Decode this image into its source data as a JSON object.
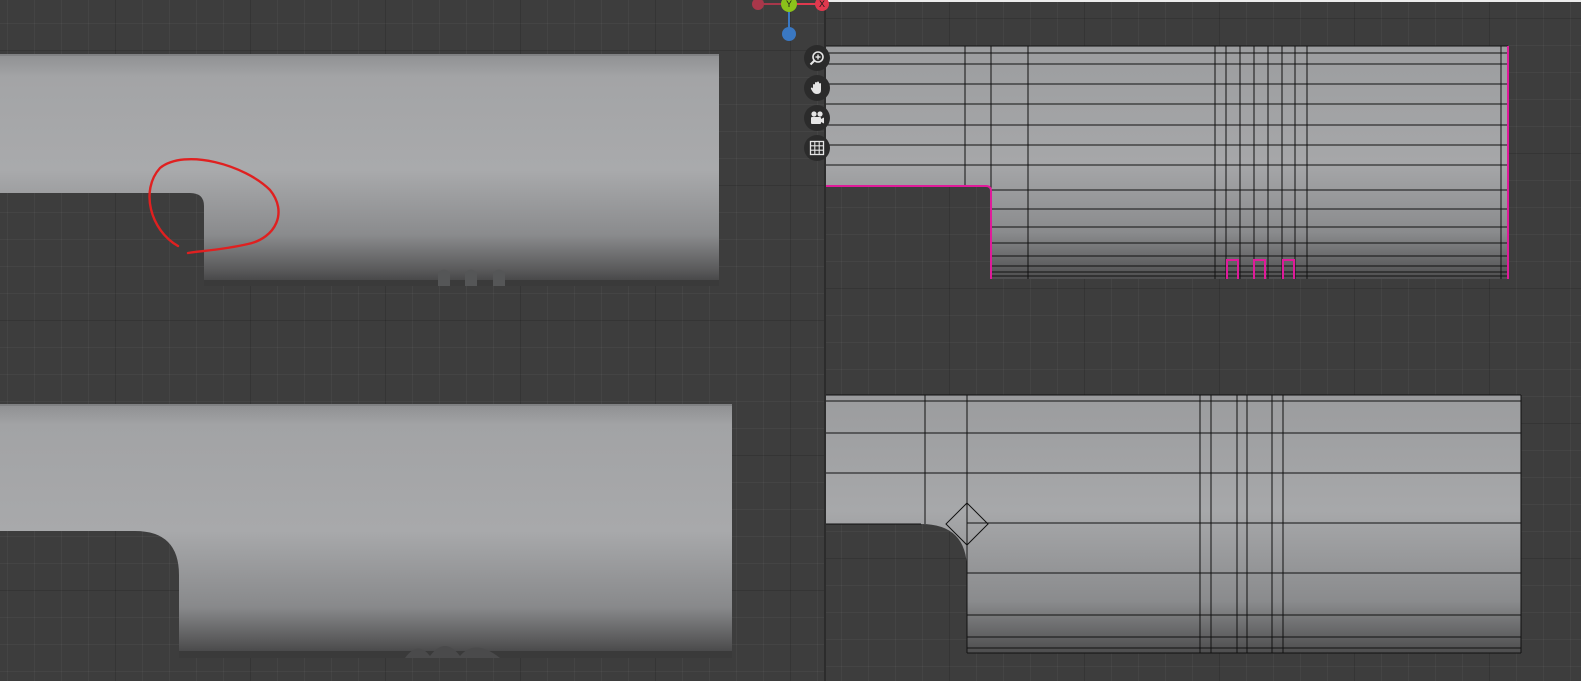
{
  "theme": {
    "viewport_bg": "#3d3d3d",
    "mesh_light": "#a6a7a9",
    "mesh_dark": "#3a3a3a",
    "selection_color": "#e01a9a",
    "annotation_color": "#e02020",
    "wire_color": "#111111"
  },
  "gizmo": {
    "y_label": "Y",
    "x_label": "X",
    "y_color": "#8bc21a",
    "x_color": "#e0394e",
    "z_color": "#3a78c2",
    "neg_x_color": "#a8374a"
  },
  "navigation_tools": [
    {
      "icon": "zoom-icon"
    },
    {
      "icon": "hand-pan-icon"
    },
    {
      "icon": "camera-orbit-icon"
    },
    {
      "icon": "grid-view-icon"
    }
  ],
  "viewports": [
    {
      "view": "shaded-with-annotation",
      "note": ""
    },
    {
      "view": "shaded-smooth"
    },
    {
      "view": "wireframe-selected-edges"
    },
    {
      "view": "wireframe-beveled-corner"
    }
  ]
}
